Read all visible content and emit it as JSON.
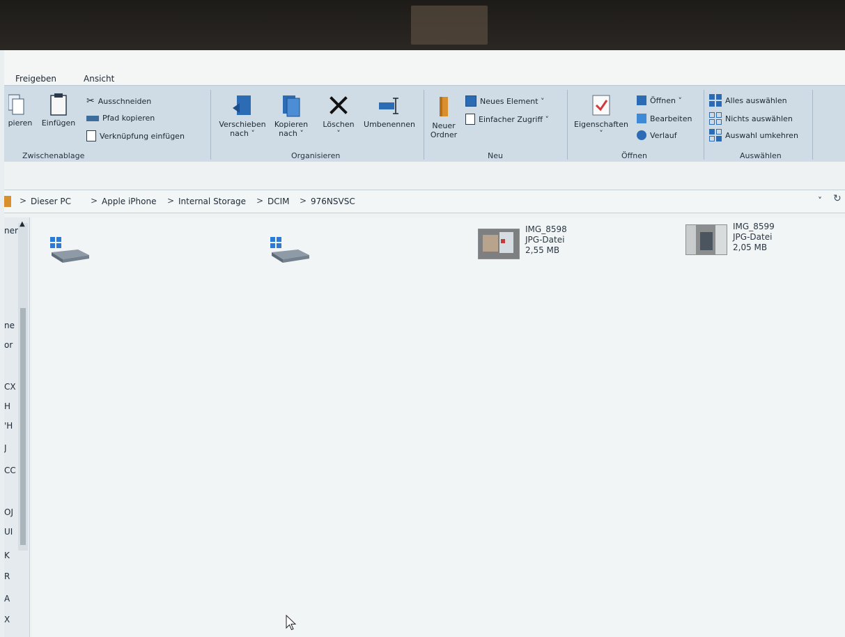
{
  "ribbon": {
    "tabs": [
      "Freigeben",
      "Ansicht"
    ],
    "clipboard": {
      "copy_partial": "pieren",
      "paste": "Einfügen",
      "cut": "Ausschneiden",
      "copy_path": "Pfad kopieren",
      "paste_shortcut": "Verknüpfung einfügen",
      "group": "Zwischenablage"
    },
    "organize": {
      "move_to_l1": "Verschieben",
      "move_to_l2": "nach ˅",
      "copy_to_l1": "Kopieren",
      "copy_to_l2": "nach ˅",
      "delete": "Löschen",
      "delete_arrow": "˅",
      "rename": "Umbenennen",
      "group": "Organisieren"
    },
    "new": {
      "new_folder_l1": "Neuer",
      "new_folder_l2": "Ordner",
      "new_item": "Neues Element ˅",
      "easy_access": "Einfacher Zugriff ˅",
      "group": "Neu"
    },
    "open": {
      "properties": "Eigenschaften",
      "properties_arrow": "˅",
      "open": "Öffnen ˅",
      "edit": "Bearbeiten",
      "history": "Verlauf",
      "group": "Öffnen"
    },
    "select": {
      "select_all": "Alles auswählen",
      "select_none": "Nichts auswählen",
      "invert": "Auswahl umkehren",
      "group": "Auswählen"
    }
  },
  "address": {
    "crumbs": [
      "Dieser PC",
      "Apple iPhone",
      "Internal Storage",
      "DCIM",
      "976NSVSC"
    ],
    "separator": ">",
    "dropdown": "˅"
  },
  "navpane": {
    "items": [
      "ner",
      "ne",
      "or",
      "CX",
      "H",
      "'H",
      "J",
      "CC",
      "OJ",
      "UI",
      "K",
      "R",
      "A",
      "X"
    ]
  },
  "files": [
    {
      "name": "IMG_8598",
      "type": "JPG-Datei",
      "size": "2,55 MB"
    },
    {
      "name": "IMG_8599",
      "type": "JPG-Datei",
      "size": "2,05 MB"
    }
  ],
  "colors": {
    "ribbon_bg": "#cfdce6",
    "accent_blue": "#2b6cb5",
    "delete_black": "#111111",
    "folder_orange": "#d9902c",
    "check_red": "#d03a3a"
  },
  "icons": [
    "drive-icon",
    "cut-icon",
    "paste-icon",
    "copy-icon",
    "move-to-icon",
    "delete-icon",
    "rename-icon",
    "new-folder-icon",
    "properties-icon",
    "select-all-icon"
  ]
}
